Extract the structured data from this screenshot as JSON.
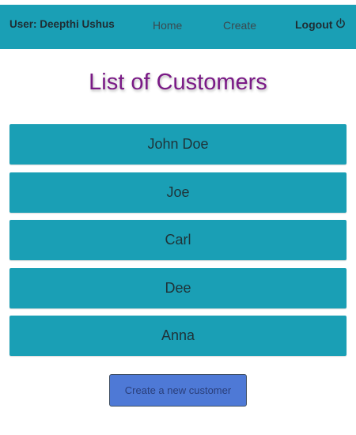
{
  "header": {
    "user_label": "User: Deepthi Ushus",
    "nav": {
      "home_label": "Home",
      "create_label": "Create",
      "logout_label": "Logout",
      "logout_icon": "power-icon"
    }
  },
  "main": {
    "title": "List of Customers",
    "customers": [
      {
        "name": "John Doe"
      },
      {
        "name": "Joe"
      },
      {
        "name": "Carl"
      },
      {
        "name": "Dee"
      },
      {
        "name": "Anna"
      }
    ],
    "create_button_label": "Create a new customer"
  },
  "colors": {
    "header_bg": "#1a9fb5",
    "list_item_bg": "#1a9fb5",
    "title_color": "#7a1a86",
    "button_bg": "#4e79d6"
  }
}
